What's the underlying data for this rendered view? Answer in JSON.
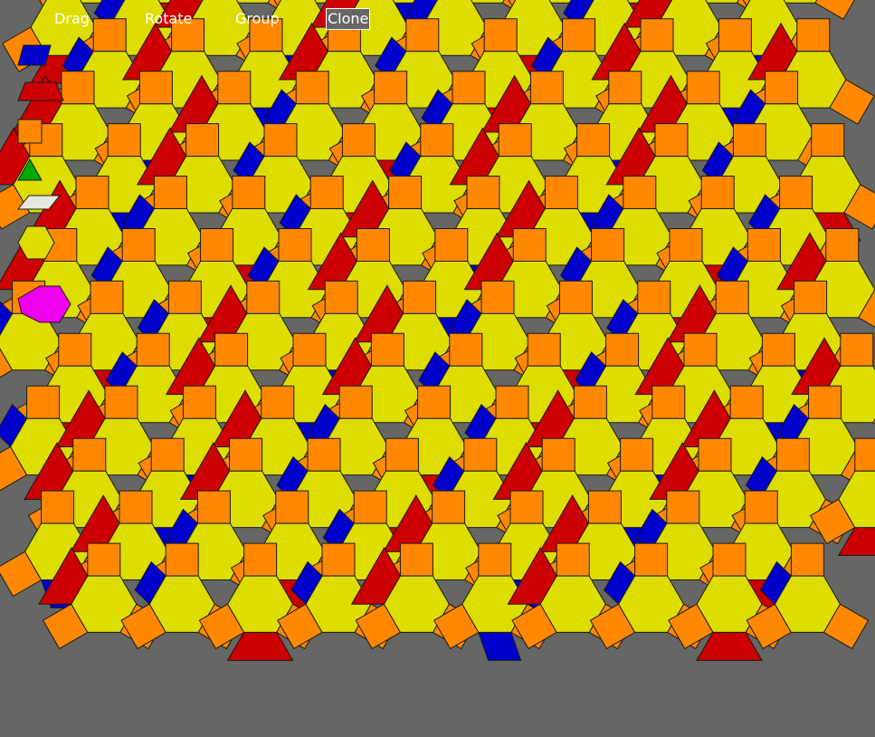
{
  "menu": {
    "drag": "Drag",
    "rotate": "Rotate",
    "group": "Group",
    "clone": "Clone",
    "selected": "clone"
  },
  "palette": [
    {
      "shape": "rhombus-narrow",
      "color": "#0000cc"
    },
    {
      "shape": "trapezoid",
      "color": "#cc0000"
    },
    {
      "shape": "square",
      "color": "#ff8800"
    },
    {
      "shape": "triangle",
      "color": "#00aa00"
    },
    {
      "shape": "rhombus-thin",
      "color": "#e8e8e0"
    },
    {
      "shape": "hexagon",
      "color": "#dddd00"
    }
  ],
  "colors": {
    "background": "#666664",
    "hexagon": "#dddd00",
    "square": "#ff8800",
    "trapezoid": "#cc0000",
    "rhombus": "#0000cc",
    "selected_piece": "#ee00ee",
    "outline": "#1a1a1a"
  }
}
